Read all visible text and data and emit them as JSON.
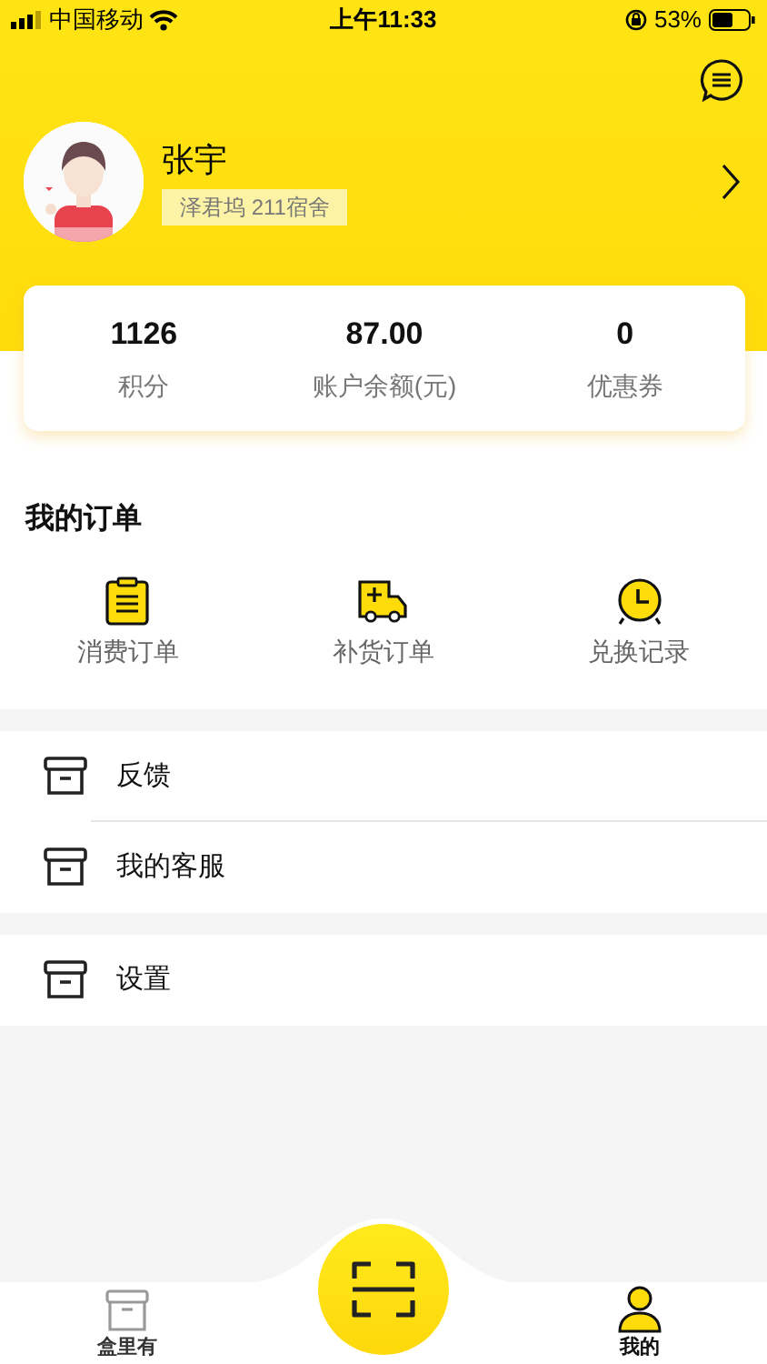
{
  "status_bar": {
    "carrier": "中国移动",
    "time": "上午11:33",
    "battery": "53%"
  },
  "profile": {
    "name": "张宇",
    "address": "泽君坞 211宿舍"
  },
  "stats": [
    {
      "value": "1126",
      "label": "积分"
    },
    {
      "value": "87.00",
      "label": "账户余额(元)"
    },
    {
      "value": "0",
      "label": "优惠券"
    }
  ],
  "orders": {
    "title": "我的订单",
    "items": [
      {
        "kind": "clipboard",
        "label": "消费订单"
      },
      {
        "kind": "truck",
        "label": "补货订单"
      },
      {
        "kind": "clock",
        "label": "兑换记录"
      }
    ]
  },
  "menu_groups": [
    [
      {
        "label": "反馈"
      },
      {
        "label": "我的客服"
      }
    ],
    [
      {
        "label": "设置"
      }
    ]
  ],
  "tab_bar": [
    {
      "label": "盒里有",
      "kind": "box",
      "selected": false
    },
    {
      "kind": "scan"
    },
    {
      "label": "我的",
      "kind": "person",
      "selected": true
    }
  ]
}
